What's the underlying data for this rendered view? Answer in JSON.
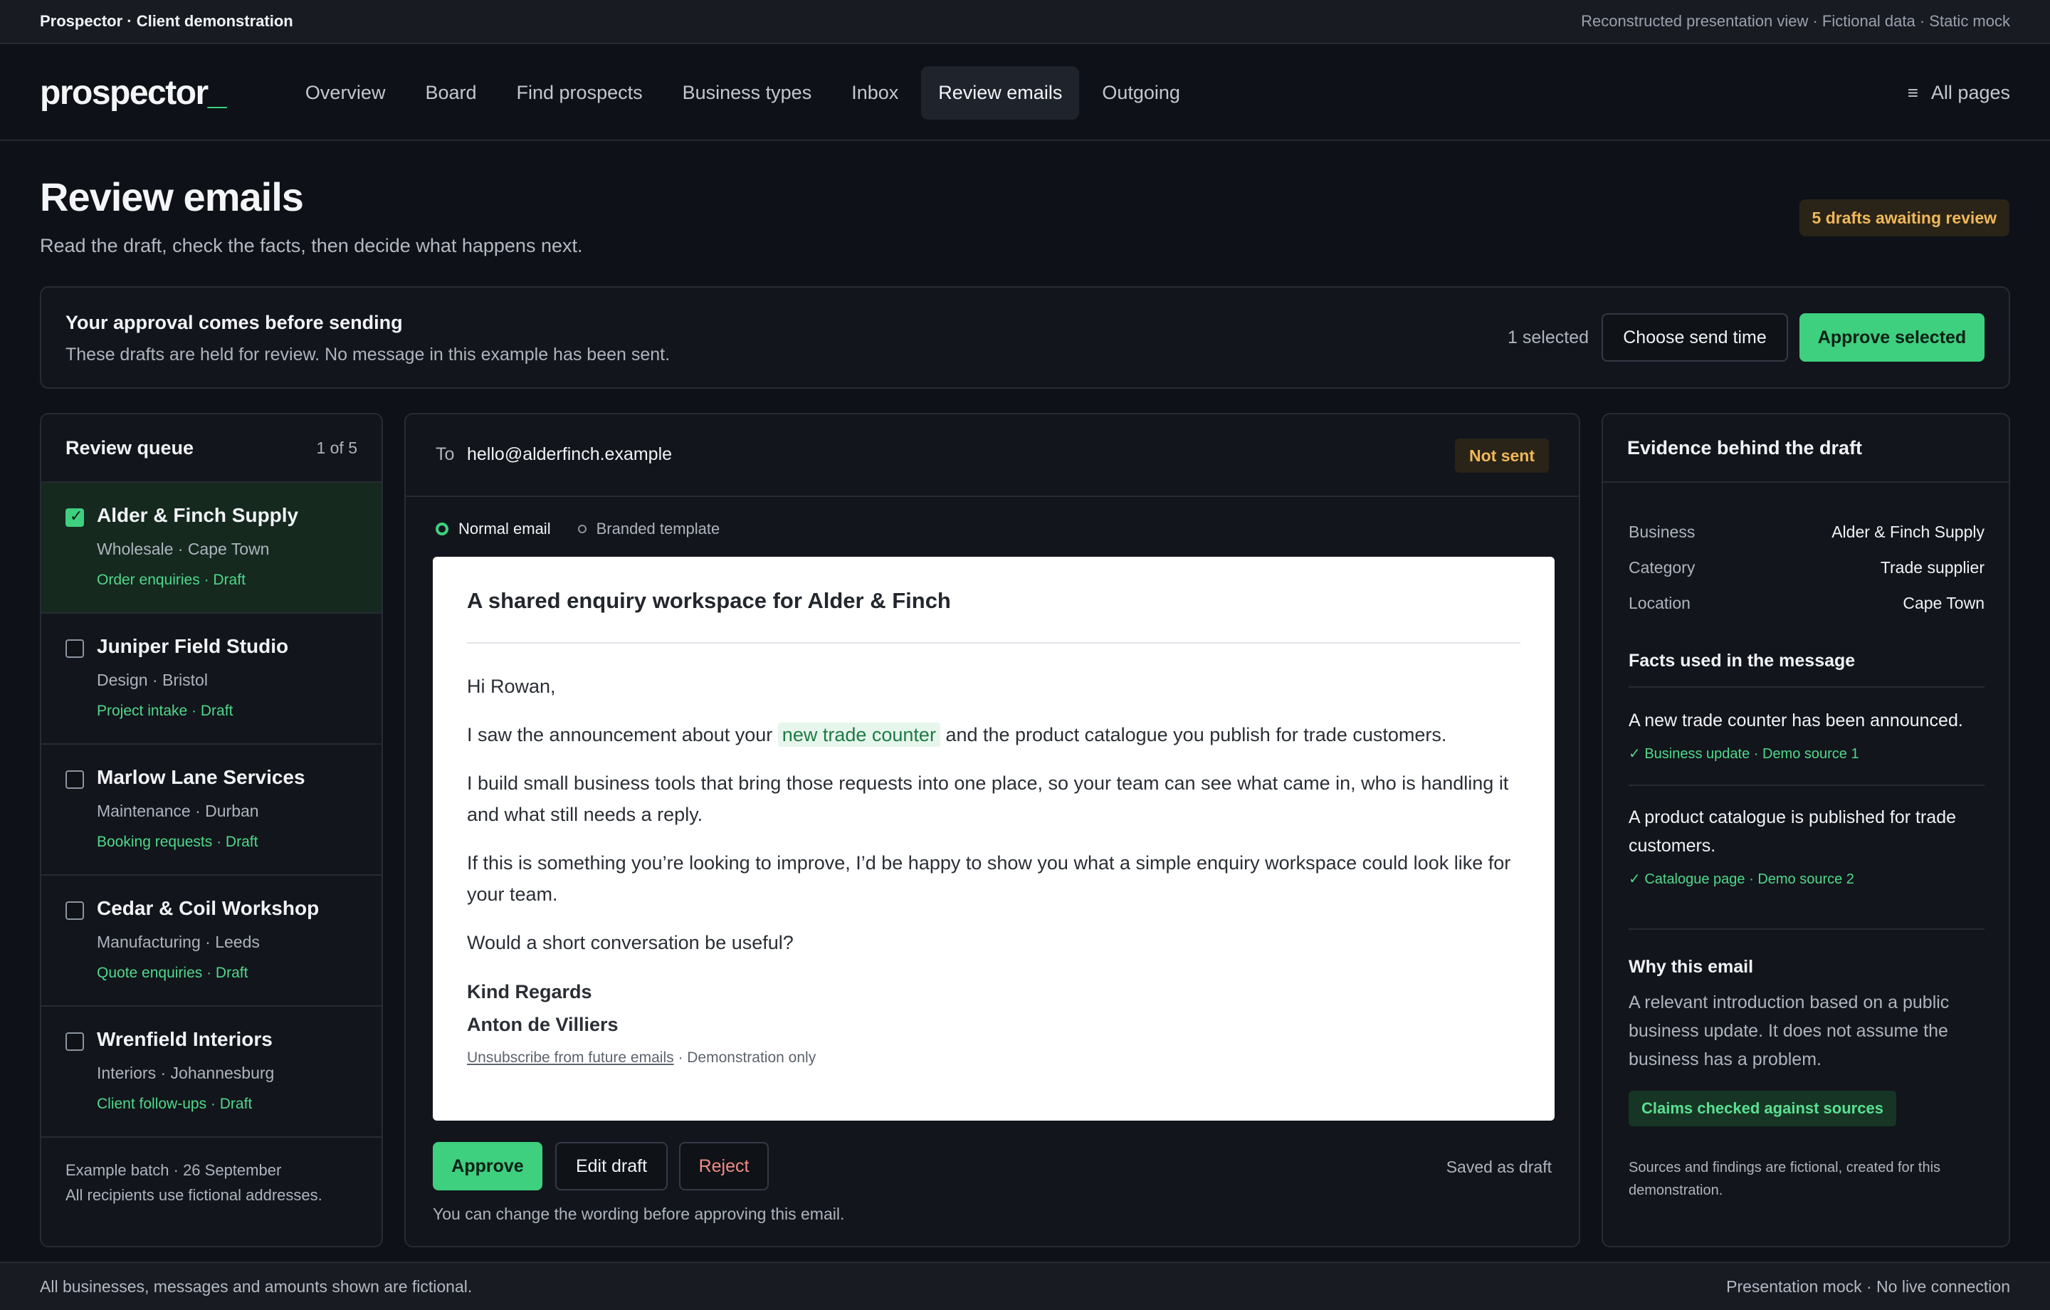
{
  "topbar": {
    "title": "Prospector · Client demonstration",
    "note": "Reconstructed presentation view · Fictional data · Static mock"
  },
  "nav": {
    "logo": "prospector",
    "logo_cursor": "_",
    "links": [
      "Overview",
      "Board",
      "Find prospects",
      "Business types",
      "Inbox",
      "Review emails",
      "Outgoing"
    ],
    "active": "Review emails",
    "all_pages": "All pages",
    "menu_icon": "≡"
  },
  "page": {
    "title": "Review emails",
    "subtitle": "Read the draft, check the facts, then decide what happens next.",
    "awaiting_badge": "5 drafts awaiting review"
  },
  "banner": {
    "title": "Your approval comes before sending",
    "subtitle": "These drafts are held for review. No message in this example has been sent.",
    "selected_count": "1 selected",
    "choose_label": "Choose send time",
    "approve_selected_label": "Approve selected"
  },
  "queue": {
    "title": "Review queue",
    "count": "1 of 5",
    "items": [
      {
        "name": "Alder & Finch Supply",
        "meta": "Wholesale · Cape Town",
        "status": "Order enquiries · Draft",
        "checked": true
      },
      {
        "name": "Juniper Field Studio",
        "meta": "Design · Bristol",
        "status": "Project intake · Draft",
        "checked": false
      },
      {
        "name": "Marlow Lane Services",
        "meta": "Maintenance · Durban",
        "status": "Booking requests · Draft",
        "checked": false
      },
      {
        "name": "Cedar & Coil Workshop",
        "meta": "Manufacturing · Leeds",
        "status": "Quote enquiries · Draft",
        "checked": false
      },
      {
        "name": "Wrenfield Interiors",
        "meta": "Interiors · Johannesburg",
        "status": "Client follow-ups · Draft",
        "checked": false
      }
    ],
    "footer_line1": "Example batch · 26 September",
    "footer_line2": "All recipients use fictional addresses."
  },
  "email": {
    "to_label": "To",
    "to_address": "hello@alderfinch.example",
    "status_badge": "Not sent",
    "mode_normal": "Normal email",
    "mode_branded": "Branded template",
    "subject": "A shared enquiry workspace for Alder & Finch",
    "greeting": "Hi Rowan,",
    "p1_before": "I saw the announcement about your ",
    "p1_highlight": "new trade counter",
    "p1_after": " and the product catalogue you publish for trade customers.",
    "p2": "I build small business tools that bring those requests into one place, so your team can see what came in, who is handling it and what still needs a reply.",
    "p3": "If this is something you’re looking to improve, I’d be happy to show you what a simple enquiry workspace could look like for your team.",
    "p4": "Would a short conversation be useful?",
    "signoff": "Kind Regards",
    "sender": "Anton de Villiers",
    "unsubscribe_link": "Unsubscribe from future emails",
    "unsubscribe_note": " · Demonstration only",
    "approve_label": "Approve",
    "edit_label": "Edit draft",
    "reject_label": "Reject",
    "saved_note": "Saved as draft",
    "hint": "You can change the wording before approving this email."
  },
  "evidence": {
    "title": "Evidence behind the draft",
    "fields": [
      {
        "key": "Business",
        "value": "Alder & Finch Supply"
      },
      {
        "key": "Category",
        "value": "Trade supplier"
      },
      {
        "key": "Location",
        "value": "Cape Town"
      }
    ],
    "facts_title": "Facts used in the message",
    "facts": [
      {
        "text": "A new trade counter has been announced.",
        "source": "✓ Business update · Demo source 1"
      },
      {
        "text": "A product catalogue is published for trade customers.",
        "source": "✓ Catalogue page · Demo source 2"
      }
    ],
    "why_title": "Why this email",
    "why_text": "A relevant introduction based on a public business update. It does not assume the business has a problem.",
    "claims_badge": "Claims checked against sources",
    "disclaimer": "Sources and findings are fictional, created for this demonstration."
  },
  "footer": {
    "left": "All businesses, messages and amounts shown are fictional.",
    "right": "Presentation mock · No live connection"
  },
  "colors": {
    "accent": "#3ecf7f",
    "background": "#0e1117",
    "warning": "#f0b85a",
    "danger": "#f28b84"
  }
}
